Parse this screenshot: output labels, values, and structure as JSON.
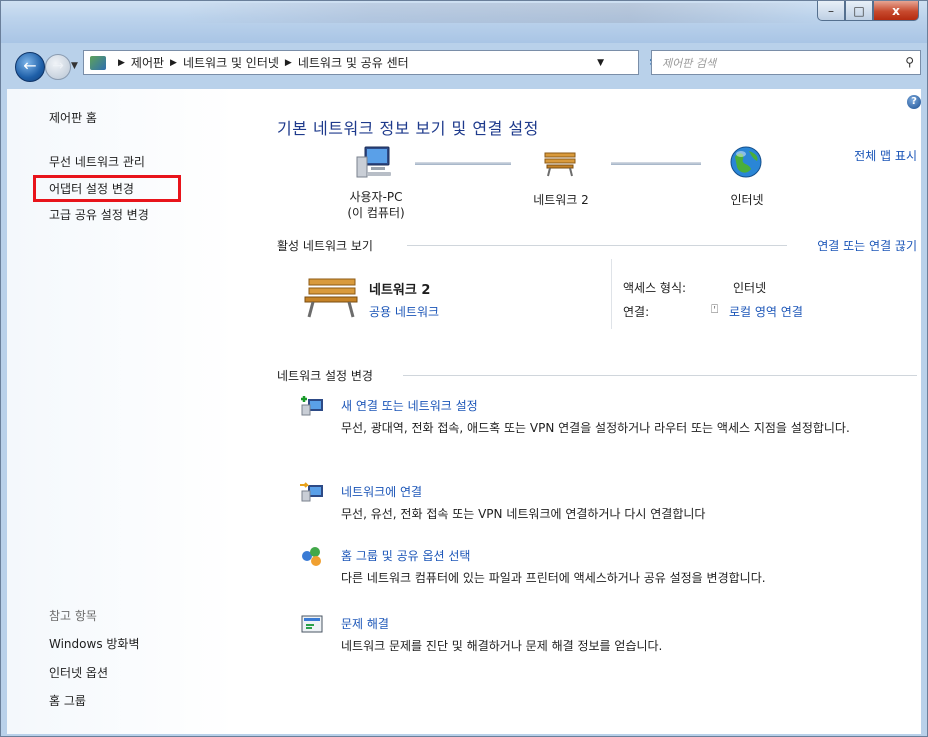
{
  "window": {
    "controls": {
      "minimize": "–",
      "maximize": "□",
      "close": "x"
    }
  },
  "address": {
    "crumbs": [
      "제어판",
      "네트워크 및 인터넷",
      "네트워크 및 공유 센터"
    ],
    "search_placeholder": "제어판 검색"
  },
  "sidebar": {
    "home": "제어판 홈",
    "items": [
      "무선 네트워크 관리",
      "어댑터 설정 변경",
      "고급 공유 설정 변경"
    ],
    "see_also_title": "참고 항목",
    "see_also": [
      "Windows 방화벽",
      "인터넷 옵션",
      "홈 그룹"
    ]
  },
  "main": {
    "title": "기본 네트워크 정보 보기 및 연결 설정",
    "full_map": "전체 맵 표시",
    "map": {
      "computer_line1": "사용자-PC",
      "computer_line2": "(이 컴퓨터)",
      "network": "네트워크 2",
      "internet": "인터넷"
    },
    "active_header": "활성 네트워크 보기",
    "disconnect_link": "연결 또는 연결 끊기",
    "active": {
      "name": "네트워크 2",
      "type": "공용 네트워크",
      "access_label": "액세스 형식:",
      "access_value": "인터넷",
      "connection_label": "연결:",
      "connection_value": "로컬 영역 연결"
    },
    "settings_header": "네트워크 설정 변경",
    "tasks": [
      {
        "title": "새 연결 또는 네트워크 설정",
        "desc": "무선, 광대역, 전화 접속, 애드혹 또는 VPN 연결을 설정하거나 라우터 또는 액세스 지점을 설정합니다."
      },
      {
        "title": "네트워크에 연결",
        "desc": "무선, 유선, 전화 접속 또는 VPN 네트워크에 연결하거나 다시 연결합니다"
      },
      {
        "title": "홈 그룹 및 공유 옵션 선택",
        "desc": "다른 네트워크 컴퓨터에 있는 파일과 프린터에 액세스하거나 공유 설정을 변경합니다."
      },
      {
        "title": "문제 해결",
        "desc": "네트워크 문제를 진단 및 해결하거나 문제 해결 정보를 얻습니다."
      }
    ]
  }
}
